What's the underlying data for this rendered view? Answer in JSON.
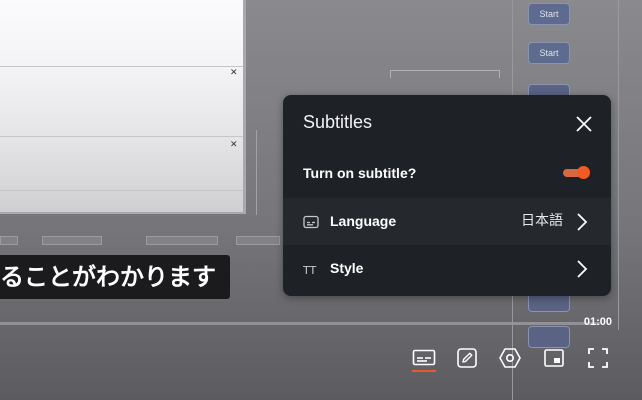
{
  "background": {
    "start_buttons": [
      "Start",
      "Start"
    ]
  },
  "caption": {
    "text": "ることがわかります"
  },
  "player": {
    "time": "01:00",
    "accent_color": "#e8592b",
    "controls": [
      "subtitles-icon",
      "pencil-icon",
      "settings-hexagon-icon",
      "picture-in-picture-icon",
      "fullscreen-icon"
    ]
  },
  "subtitles_menu": {
    "title": "Subtitles",
    "toggle_label": "Turn on subtitle?",
    "toggle_on": true,
    "language_label": "Language",
    "language_value": "日本語",
    "style_label": "Style",
    "style_icon_text": "TT"
  }
}
